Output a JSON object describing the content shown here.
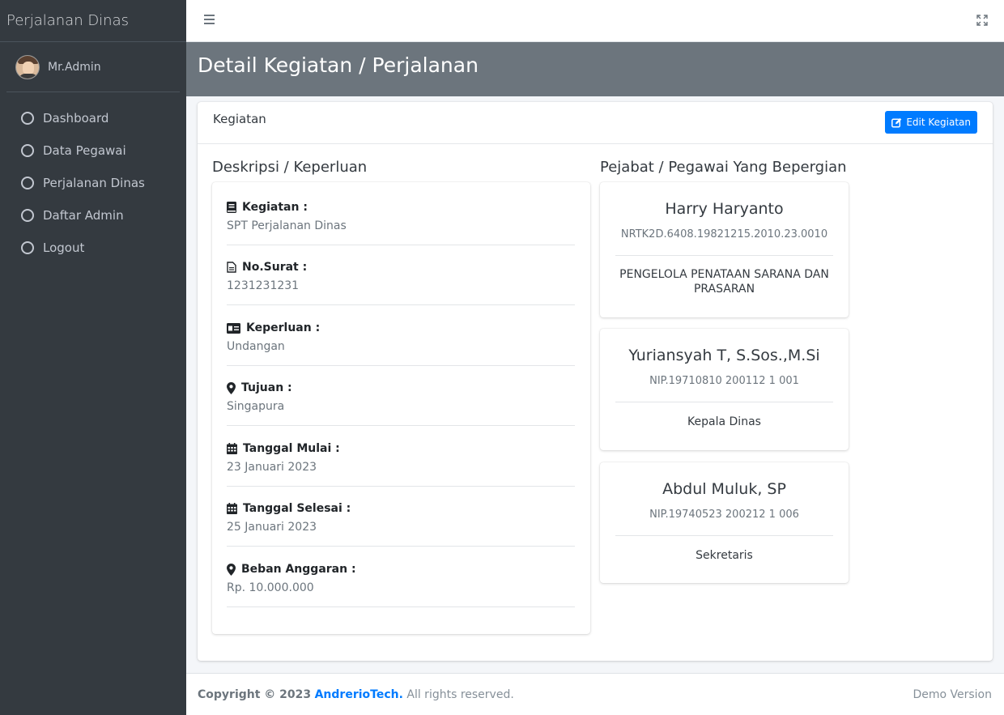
{
  "sidebar": {
    "brand": "Perjalanan Dinas",
    "user": "Mr.Admin",
    "items": [
      {
        "label": "Dashboard"
      },
      {
        "label": "Data Pegawai"
      },
      {
        "label": "Perjalanan Dinas"
      },
      {
        "label": "Daftar Admin"
      },
      {
        "label": "Logout"
      }
    ]
  },
  "header": {
    "title": "Detail Kegiatan / Perjalanan"
  },
  "card": {
    "title": "Kegiatan",
    "edit_label": "Edit Kegiatan",
    "desc_title": "Deskripsi / Keperluan",
    "people_title": "Pejabat / Pegawai Yang Bepergian"
  },
  "details": [
    {
      "icon": "book-icon",
      "label": "Kegiatan :",
      "value": "SPT Perjalanan Dinas"
    },
    {
      "icon": "file-icon",
      "label": "No.Surat :",
      "value": "1231231231"
    },
    {
      "icon": "id-card-icon",
      "label": "Keperluan :",
      "value": "Undangan"
    },
    {
      "icon": "map-marker-icon",
      "label": "Tujuan :",
      "value": "Singapura"
    },
    {
      "icon": "calendar-icon",
      "label": "Tanggal Mulai :",
      "value": "23 Januari 2023"
    },
    {
      "icon": "calendar-icon",
      "label": "Tanggal Selesai :",
      "value": "25 Januari 2023"
    },
    {
      "icon": "map-marker-icon",
      "label": "Beban Anggaran :",
      "value": "Rp. 10.000.000"
    }
  ],
  "people": [
    {
      "name": "Harry Haryanto",
      "nip": "NRTK2D.6408.19821215.2010.23.0010",
      "role": "PENGELOLA PENATAAN SARANA DAN PRASARAN"
    },
    {
      "name": "Yuriansyah T, S.Sos.,M.Si",
      "nip": "NIP.19710810 200112 1 001",
      "role": "Kepala Dinas"
    },
    {
      "name": "Abdul Muluk, SP",
      "nip": "NIP.19740523 200212 1 006",
      "role": "Sekretaris"
    }
  ],
  "footer": {
    "copyright_prefix": "Copyright © 2023",
    "brand": "AndrerioTech.",
    "rights": "All rights reserved.",
    "version": "Demo Version"
  },
  "colors": {
    "sidebar_bg": "#343a40",
    "header_bg": "#6c757d",
    "accent": "#007bff"
  }
}
